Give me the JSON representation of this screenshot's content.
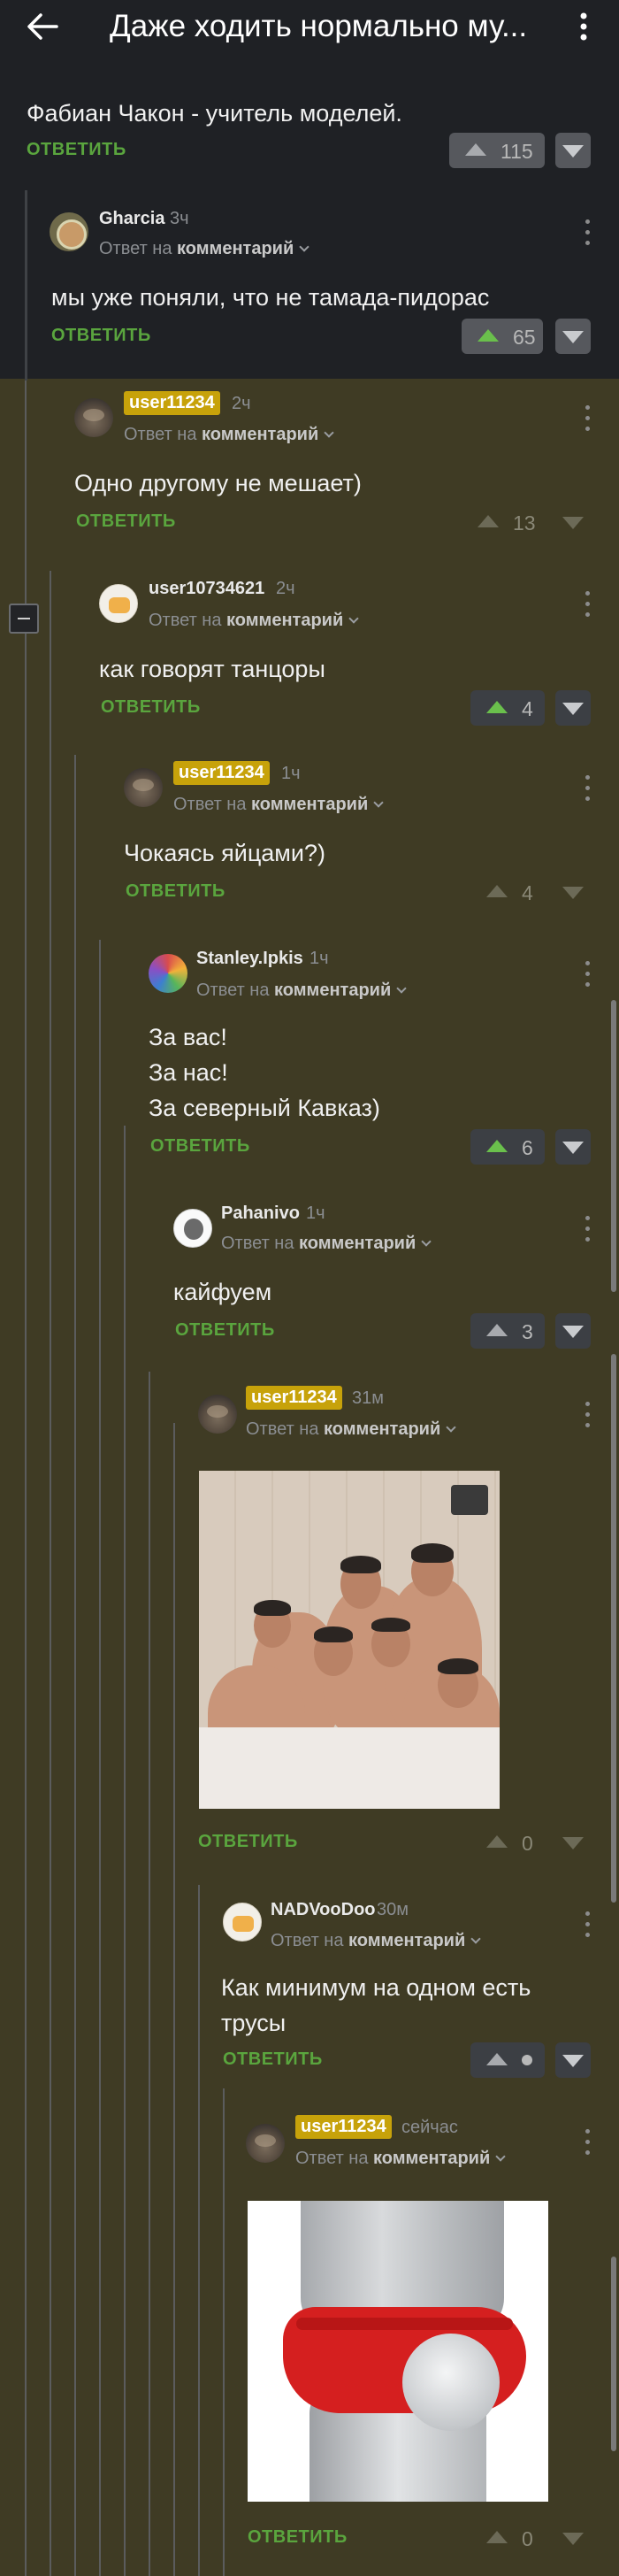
{
  "header": {
    "title": "Даже ходить нормально му..."
  },
  "comments": [
    {
      "text": "Фабиан Чакон - учитель моделей.",
      "reply_label": "ОТВЕТИТЬ",
      "votes": "115"
    },
    {
      "user": "Gharcia",
      "time": "3ч",
      "reply_to_prefix": "Ответ на",
      "reply_to_target": "комментарий",
      "text": "мы уже поняли, что не тамада-пидорас",
      "reply_label": "ОТВЕТИТЬ",
      "votes": "65"
    },
    {
      "user": "user11234",
      "time": "2ч",
      "reply_to_prefix": "Ответ на",
      "reply_to_target": "комментарий",
      "text": "Одно другому не мешает)",
      "reply_label": "ОТВЕТИТЬ",
      "votes": "13"
    },
    {
      "user": "user10734621",
      "time": "2ч",
      "reply_to_prefix": "Ответ на",
      "reply_to_target": "комментарий",
      "text": "как говорят танцоры",
      "reply_label": "ОТВЕТИТЬ",
      "votes": "4"
    },
    {
      "user": "user11234",
      "time": "1ч",
      "reply_to_prefix": "Ответ на",
      "reply_to_target": "комментарий",
      "text": "Чокаясь яйцами?)",
      "reply_label": "ОТВЕТИТЬ",
      "votes": "4"
    },
    {
      "user": "Stanley.Ipkis",
      "time": "1ч",
      "reply_to_prefix": "Ответ на",
      "reply_to_target": "комментарий",
      "text_lines": [
        "За вас!",
        "За нас!",
        "За северный Кавказ)"
      ],
      "reply_label": "ОТВЕТИТЬ",
      "votes": "6"
    },
    {
      "user": "Pahanivo",
      "time": "1ч",
      "reply_to_prefix": "Ответ на",
      "reply_to_target": "комментарий",
      "text": "кайфуем",
      "reply_label": "ОТВЕТИТЬ",
      "votes": "3"
    },
    {
      "user": "user11234",
      "time": "31м",
      "reply_to_prefix": "Ответ на",
      "reply_to_target": "комментарий",
      "reply_label": "ОТВЕТИТЬ",
      "votes": "0"
    },
    {
      "user": "NADVooDoo",
      "time": "30м",
      "reply_to_prefix": "Ответ на",
      "reply_to_target": "комментарий",
      "text_lines": [
        "Как минимум на одном есть",
        "трусы"
      ],
      "reply_label": "ОТВЕТИТЬ"
    },
    {
      "user": "user11234",
      "time": "сейчас",
      "reply_to_prefix": "Ответ на",
      "reply_to_target": "комментарий",
      "reply_label": "ОТВЕТИТЬ",
      "votes": "0"
    }
  ],
  "colors": {
    "dark_bg": "#1f2125",
    "olive_bg": "#3f3b24",
    "accent_green": "#5aa53e",
    "badge_yellow": "#c7a20a"
  },
  "icons": [
    "back-arrow-icon",
    "more-vertical-icon",
    "upvote-icon",
    "downvote-icon",
    "collapse-icon",
    "chevron-down-icon"
  ]
}
